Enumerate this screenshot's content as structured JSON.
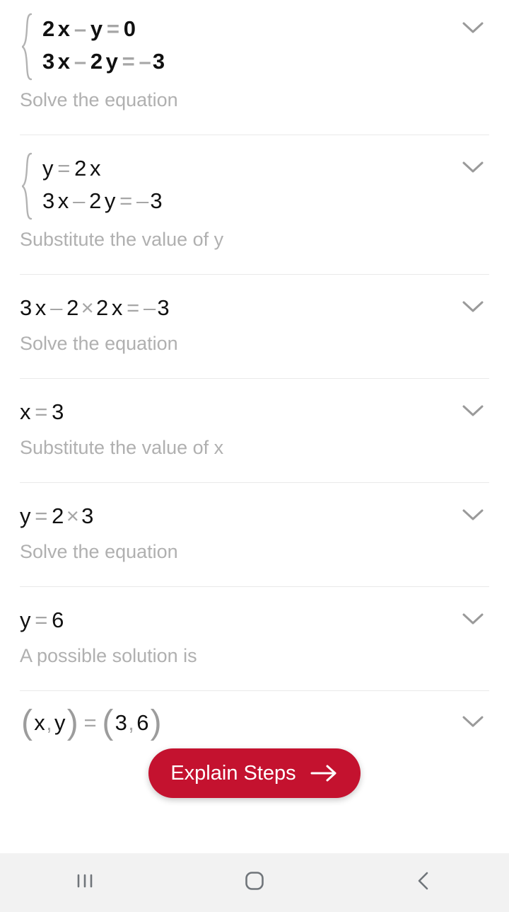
{
  "app": {
    "background": "#ffffff",
    "accent_color": "#c4122f",
    "text_color": "#111111",
    "caption_color": "#b0b0b0",
    "operator_color": "#a6a6a6",
    "divider_color": "#e9e9e9"
  },
  "steps": [
    {
      "kind": "system",
      "bold": true,
      "equations": [
        [
          {
            "t": "2",
            "s": "num"
          },
          {
            "t": "x",
            "s": "var"
          },
          {
            "t": "–",
            "s": "op"
          },
          {
            "t": "y",
            "s": "var"
          },
          {
            "t": "=",
            "s": "op"
          },
          {
            "t": "0",
            "s": "num"
          }
        ],
        [
          {
            "t": "3",
            "s": "num"
          },
          {
            "t": "x",
            "s": "var"
          },
          {
            "t": "–",
            "s": "op"
          },
          {
            "t": "2",
            "s": "num"
          },
          {
            "t": "y",
            "s": "var"
          },
          {
            "t": "=",
            "s": "op"
          },
          {
            "t": "–",
            "s": "neg"
          },
          {
            "t": "3",
            "s": "num"
          }
        ]
      ],
      "plain": "2x – y = 0 ; 3x – 2y = – 3",
      "caption": "Solve the equation",
      "expand_icon": "chevron-down-icon"
    },
    {
      "kind": "system",
      "bold": false,
      "equations": [
        [
          {
            "t": "y",
            "s": "var"
          },
          {
            "t": "=",
            "s": "op"
          },
          {
            "t": "2",
            "s": "num"
          },
          {
            "t": "x",
            "s": "var"
          }
        ],
        [
          {
            "t": "3",
            "s": "num"
          },
          {
            "t": "x",
            "s": "var"
          },
          {
            "t": "–",
            "s": "op"
          },
          {
            "t": "2",
            "s": "num"
          },
          {
            "t": "y",
            "s": "var"
          },
          {
            "t": "=",
            "s": "op"
          },
          {
            "t": "–",
            "s": "neg"
          },
          {
            "t": "3",
            "s": "num"
          }
        ]
      ],
      "plain": "y = 2x ; 3x – 2y = – 3",
      "caption": "Substitute the value of y",
      "expand_icon": "chevron-down-icon"
    },
    {
      "kind": "single",
      "bold": false,
      "equation": [
        {
          "t": "3",
          "s": "num"
        },
        {
          "t": "x",
          "s": "var"
        },
        {
          "t": "–",
          "s": "op"
        },
        {
          "t": "2",
          "s": "num"
        },
        {
          "t": "×",
          "s": "op"
        },
        {
          "t": "2",
          "s": "num"
        },
        {
          "t": "x",
          "s": "var"
        },
        {
          "t": "=",
          "s": "op"
        },
        {
          "t": "–",
          "s": "neg"
        },
        {
          "t": "3",
          "s": "num"
        }
      ],
      "plain": "3x – 2 × 2x = – 3",
      "caption": "Solve the equation",
      "expand_icon": "chevron-down-icon"
    },
    {
      "kind": "single",
      "bold": false,
      "equation": [
        {
          "t": "x",
          "s": "var"
        },
        {
          "t": "=",
          "s": "op"
        },
        {
          "t": "3",
          "s": "num"
        }
      ],
      "plain": "x = 3",
      "caption": "Substitute the value of x",
      "expand_icon": "chevron-down-icon"
    },
    {
      "kind": "single",
      "bold": false,
      "equation": [
        {
          "t": "y",
          "s": "var"
        },
        {
          "t": "=",
          "s": "op"
        },
        {
          "t": "2",
          "s": "num"
        },
        {
          "t": "×",
          "s": "op"
        },
        {
          "t": "3",
          "s": "num"
        }
      ],
      "plain": "y = 2 × 3",
      "caption": "Solve the equation",
      "expand_icon": "chevron-down-icon"
    },
    {
      "kind": "single",
      "bold": false,
      "equation": [
        {
          "t": "y",
          "s": "var"
        },
        {
          "t": "=",
          "s": "op"
        },
        {
          "t": "6",
          "s": "num"
        }
      ],
      "plain": "y = 6",
      "caption": "A possible solution is",
      "expand_icon": "chevron-down-icon"
    },
    {
      "kind": "tuple",
      "bold": false,
      "equation": [
        {
          "t": "(",
          "s": "paren"
        },
        {
          "t": "x",
          "s": "var"
        },
        {
          "t": ",",
          "s": "comma"
        },
        {
          "t": "y",
          "s": "var"
        },
        {
          "t": ")",
          "s": "paren"
        },
        {
          "t": "=",
          "s": "op"
        },
        {
          "t": "(",
          "s": "paren"
        },
        {
          "t": "3",
          "s": "num"
        },
        {
          "t": ",",
          "s": "comma"
        },
        {
          "t": "6",
          "s": "num"
        },
        {
          "t": ")",
          "s": "paren"
        }
      ],
      "plain": "( x , y ) = ( 3 , 6 )",
      "caption": "",
      "expand_icon": "chevron-down-icon"
    }
  ],
  "explain_button": {
    "label": "Explain Steps",
    "arrow_icon": "arrow-right-icon",
    "color": "#c4122f",
    "text_color": "#ffffff"
  },
  "navbar": {
    "background": "#f2f2f2",
    "buttons": [
      {
        "name": "recents-button",
        "icon": "recents-icon",
        "label": "Recents"
      },
      {
        "name": "home-button",
        "icon": "home-icon",
        "label": "Home"
      },
      {
        "name": "back-button",
        "icon": "back-icon",
        "label": "Back"
      }
    ]
  }
}
